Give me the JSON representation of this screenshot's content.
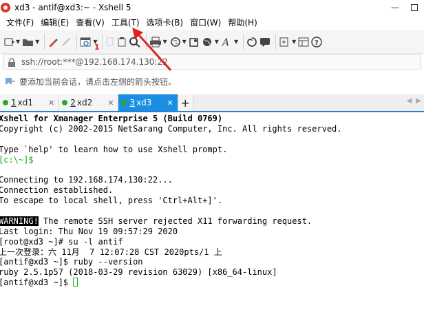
{
  "window": {
    "title": "xd3 - antif@xd3:~ - Xshell 5"
  },
  "menu": [
    "文件(F)",
    "编辑(E)",
    "查看(V)",
    "工具(T)",
    "选项卡(B)",
    "窗口(W)",
    "帮助(H)"
  ],
  "address": {
    "value": "ssh://root:***@192.168.174.130:22"
  },
  "hint": {
    "text": "要添加当前会话，请点击左侧的箭头按钮。"
  },
  "tabs": [
    {
      "num": "1",
      "label": "xd1",
      "active": false
    },
    {
      "num": "2",
      "label": "xd2",
      "active": false
    },
    {
      "num": "3",
      "label": "xd3",
      "active": true
    }
  ],
  "annotation": {
    "number": "1"
  },
  "terminal": {
    "header": "Xshell for Xmanager Enterprise 5 (Build 0769)",
    "copyright": "Copyright (c) 2002-2015 NetSarang Computer, Inc. All rights reserved.",
    "help": "Type `help' to learn how to use Xshell prompt.",
    "prompt_local": "[c:\\~]$",
    "connecting": "Connecting to 192.168.174.130:22...",
    "established": "Connection established.",
    "escape": "To escape to local shell, press 'Ctrl+Alt+]'.",
    "warning_badge": "WARNING!",
    "warning_text": " The remote SSH server rejected X11 forwarding request.",
    "last_login": "Last login: Thu Nov 19 09:57:29 2020",
    "su_cmd": "[root@xd3 ~]# su -l antif",
    "last_login_cn": "上一次登录：六 11月  7 12:07:28 CST 2020pts/1 上",
    "ruby_cmd": "[antif@xd3 ~]$ ruby --version",
    "ruby_ver": "ruby 2.5.1p57 (2018-03-29 revision 63029) [x86_64-linux]",
    "final_prompt": "[antif@xd3 ~]$ "
  },
  "colors": {
    "accent": "#1a8ee0",
    "prompt_green": "#0aa80a",
    "annotation_red": "#e02020"
  }
}
